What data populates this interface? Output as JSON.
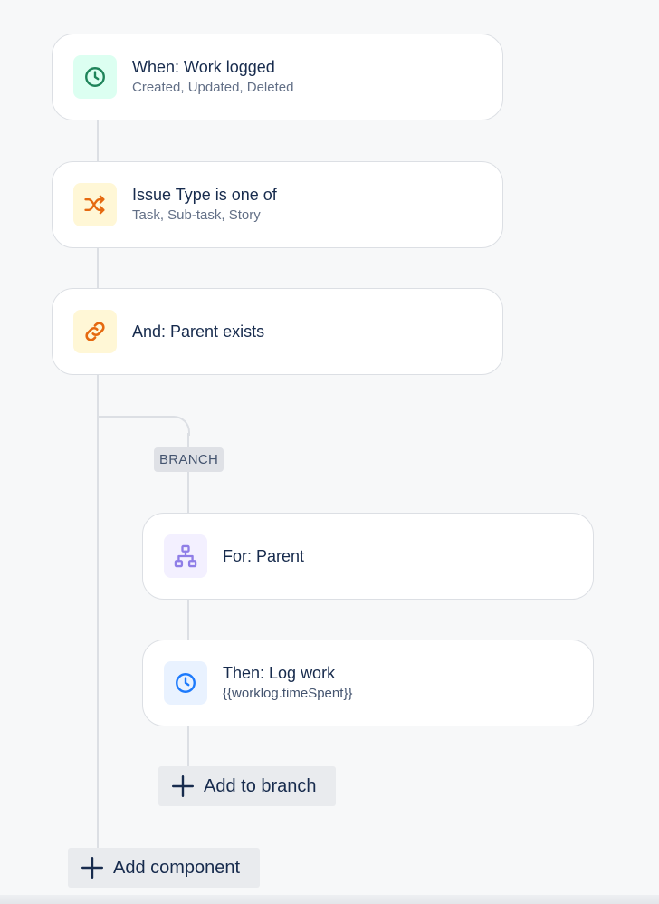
{
  "trigger": {
    "title": "When: Work logged",
    "subtitle": "Created, Updated, Deleted",
    "icon": "clock-icon",
    "icon_color": "#1f845a",
    "icon_bg": "#dcfff1"
  },
  "condition_issue_type": {
    "title": "Issue Type is one of",
    "subtitle": "Task, Sub-task, Story",
    "icon": "shuffle-icon",
    "icon_color": "#e56910",
    "icon_bg": "#fff7d6"
  },
  "condition_parent": {
    "title": "And: Parent exists",
    "icon": "link-icon",
    "icon_color": "#e56910",
    "icon_bg": "#fff7d6"
  },
  "branch": {
    "label": "BRANCH",
    "for_card": {
      "title": "For: Parent",
      "icon": "hierarchy-icon",
      "icon_color": "#8f7ee7",
      "icon_bg": "#f3f0ff"
    },
    "action_card": {
      "title": "Then: Log work",
      "subtitle": "{{worklog.timeSpent}}",
      "icon": "clock-icon",
      "icon_color": "#1d7afc",
      "icon_bg": "#e9f2ff"
    },
    "add_label": "Add to branch"
  },
  "add_component_label": "Add component"
}
